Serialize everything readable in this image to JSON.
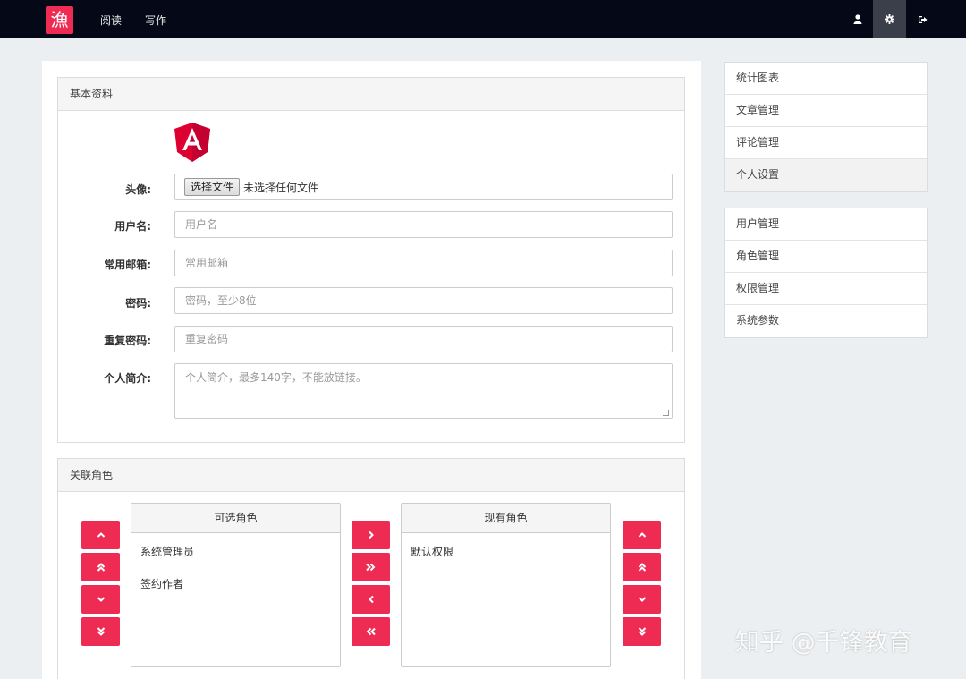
{
  "navbar": {
    "logo_text": "漁",
    "links": [
      {
        "label": "阅读"
      },
      {
        "label": "写作"
      }
    ],
    "icons": [
      "user-icon",
      "gear-icon",
      "sign-out-icon"
    ],
    "brand_color": "#ee2b53"
  },
  "basic_profile": {
    "title": "基本资料",
    "avatar_label": "头像:",
    "file_button": "选择文件",
    "file_status": "未选择任何文件",
    "fields": [
      {
        "label": "用户名:",
        "placeholder": "用户名"
      },
      {
        "label": "常用邮箱:",
        "placeholder": "常用邮箱"
      },
      {
        "label": "密码:",
        "placeholder": "密码，至少8位"
      },
      {
        "label": "重复密码:",
        "placeholder": "重复密码"
      },
      {
        "label": "个人简介:",
        "placeholder": "个人简介，最多140字，不能放链接。"
      }
    ],
    "avatar_logo_letter": "A"
  },
  "roles": {
    "title": "关联角色",
    "available": {
      "header": "可选角色",
      "items": [
        "系统管理员",
        "签约作者"
      ]
    },
    "current": {
      "header": "现有角色",
      "items": [
        "默认权限"
      ]
    },
    "left_buttons": [
      "move-up",
      "move-top",
      "move-down",
      "move-bottom"
    ],
    "middle_buttons": [
      "add-selected",
      "add-all",
      "remove-selected",
      "remove-all"
    ],
    "right_buttons": [
      "move-up",
      "move-top",
      "move-down",
      "move-bottom"
    ]
  },
  "sidebar": {
    "group1": [
      {
        "label": "统计图表",
        "active": false
      },
      {
        "label": "文章管理",
        "active": false
      },
      {
        "label": "评论管理",
        "active": false
      },
      {
        "label": "个人设置",
        "active": true
      }
    ],
    "group2": [
      {
        "label": "用户管理"
      },
      {
        "label": "角色管理"
      },
      {
        "label": "权限管理"
      },
      {
        "label": "系统参数"
      }
    ]
  },
  "watermark": "知乎 @千锋教育"
}
